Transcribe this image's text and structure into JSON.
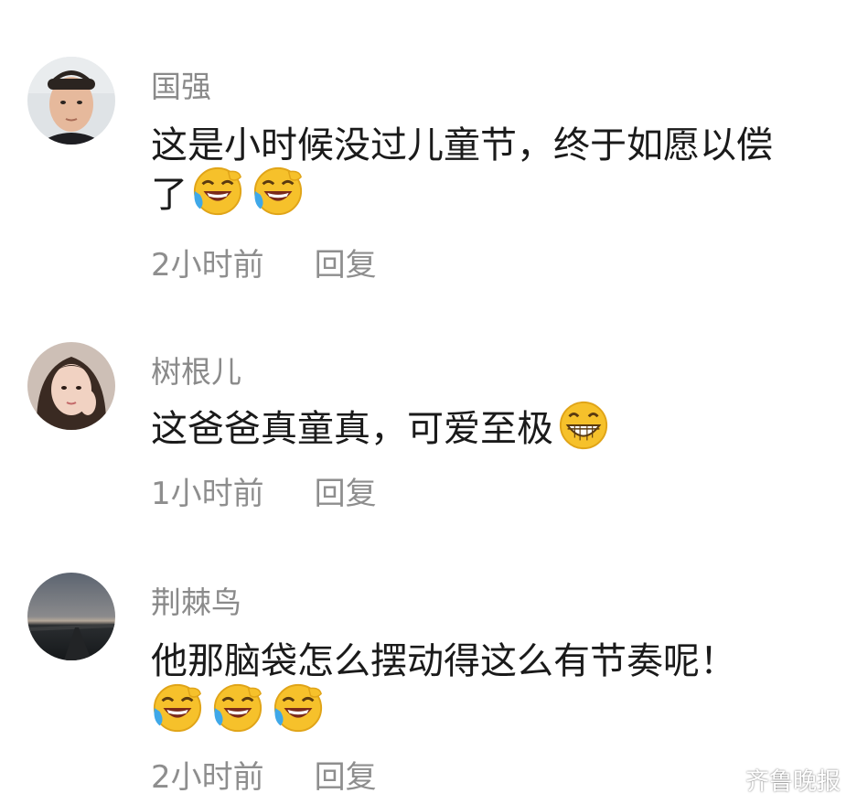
{
  "comments": [
    {
      "username": "国强",
      "text_line1": "这是小时候没过儿童节，终于如愿以偿",
      "text_line2": "了",
      "emojis": [
        "laugh-cry-emoji",
        "laugh-cry-emoji"
      ],
      "time": "2小时前",
      "reply": "回复"
    },
    {
      "username": "树根儿",
      "text_line1": "这爸爸真童真，可爱至极",
      "emojis": [
        "grin-emoji"
      ],
      "time": "1小时前",
      "reply": "回复"
    },
    {
      "username": "荆棘鸟",
      "text_line1": "他那脑袋怎么摆动得这么有节奏呢！",
      "emojis": [
        "laugh-cry-emoji",
        "laugh-cry-emoji",
        "laugh-cry-emoji"
      ],
      "time": "2小时前",
      "reply": "回复"
    }
  ],
  "watermark": {
    "text": "齐鲁晚报",
    "icon": "wechat-icon"
  },
  "colors": {
    "username": "#8a8a8a",
    "text": "#1a1a1a",
    "meta": "#8e8e8e",
    "emoji_face": "#f6c12b"
  }
}
